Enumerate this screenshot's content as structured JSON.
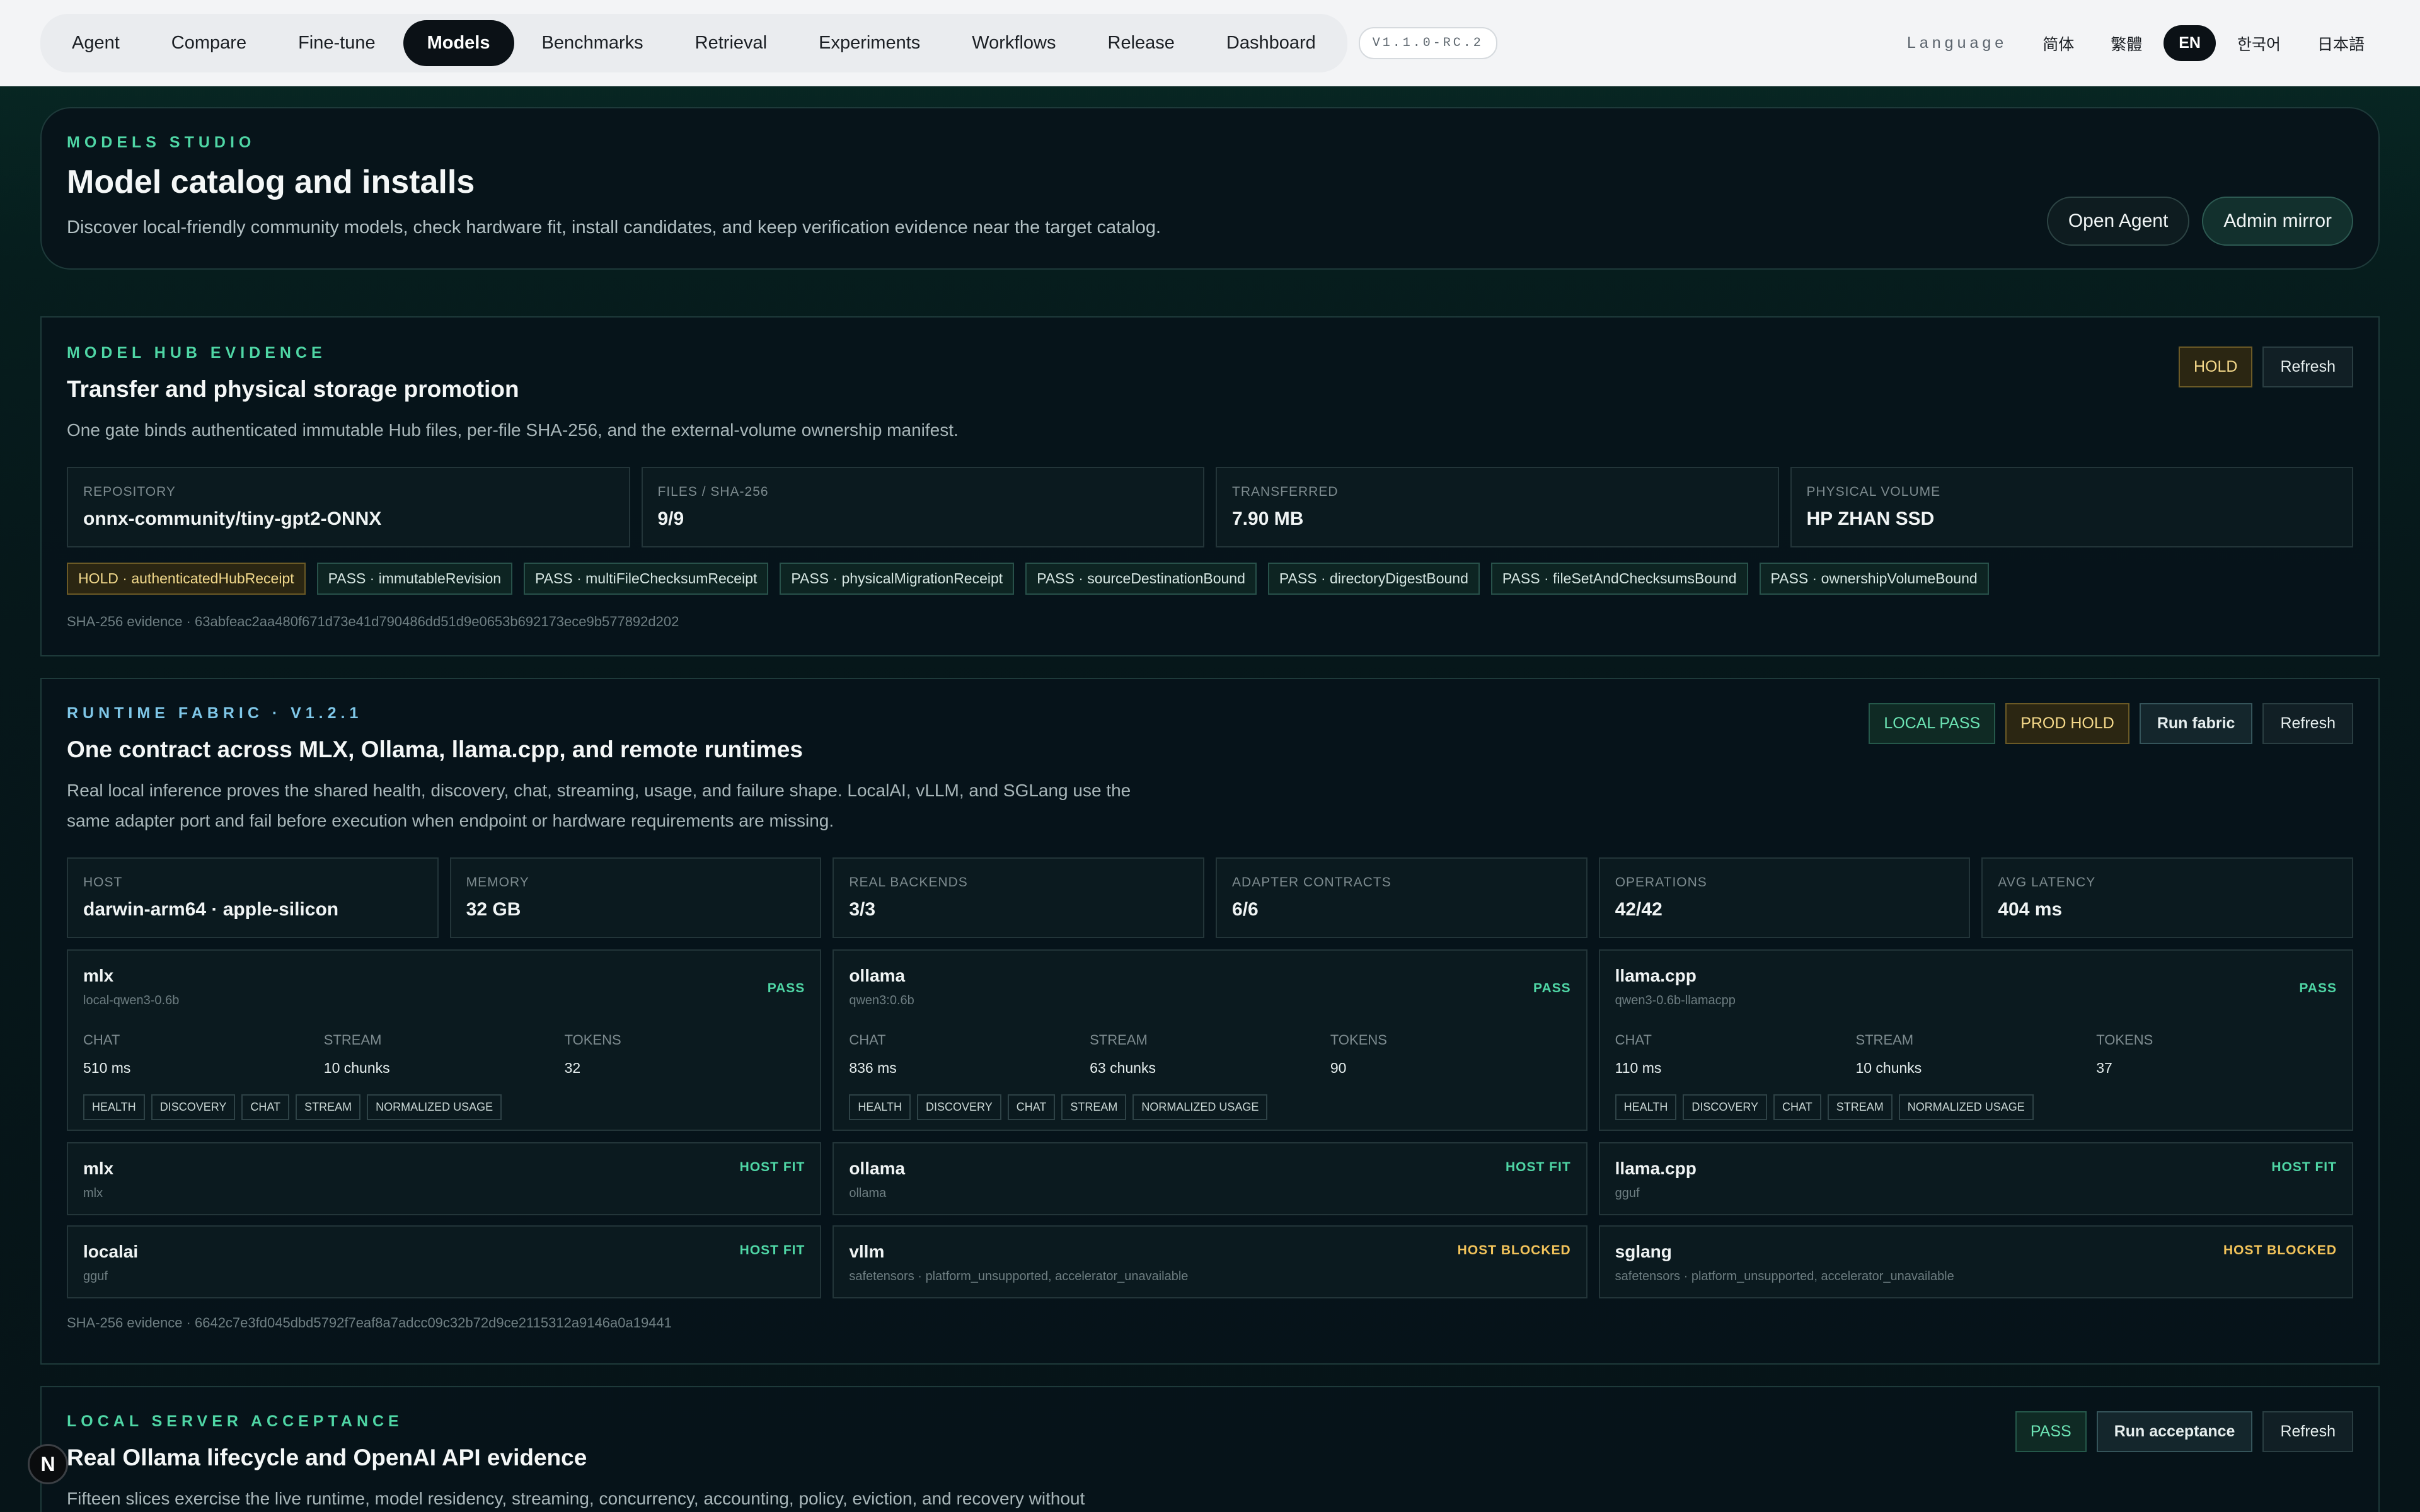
{
  "nav": {
    "items": [
      "Agent",
      "Compare",
      "Fine-tune",
      "Models",
      "Benchmarks",
      "Retrieval",
      "Experiments",
      "Workflows",
      "Release",
      "Dashboard"
    ],
    "active": "Models",
    "version": "V1.1.0-RC.2"
  },
  "language": {
    "label": "Language",
    "options": [
      "简体",
      "繁體",
      "EN",
      "한국어",
      "日本語"
    ],
    "active": "EN"
  },
  "hero": {
    "eyebrow": "MODELS STUDIO",
    "title": "Model catalog and installs",
    "description": "Discover local-friendly community models, check hardware fit, install candidates, and keep verification evidence near the target catalog.",
    "open_agent": "Open Agent",
    "admin_mirror": "Admin mirror"
  },
  "hub": {
    "eyebrow": "MODEL HUB EVIDENCE",
    "title": "Transfer and physical storage promotion",
    "description": "One gate binds authenticated immutable Hub files, per-file SHA-256, and the external-volume ownership manifest.",
    "status": "HOLD",
    "refresh": "Refresh",
    "stats": [
      {
        "label": "REPOSITORY",
        "value": "onnx-community/tiny-gpt2-ONNX"
      },
      {
        "label": "FILES / SHA-256",
        "value": "9/9"
      },
      {
        "label": "TRANSFERRED",
        "value": "7.90 MB"
      },
      {
        "label": "PHYSICAL VOLUME",
        "value": "HP ZHAN SSD"
      }
    ],
    "checks": [
      {
        "text": "HOLD · authenticatedHubReceipt",
        "state": "hold"
      },
      {
        "text": "PASS · immutableRevision",
        "state": "pass"
      },
      {
        "text": "PASS · multiFileChecksumReceipt",
        "state": "pass"
      },
      {
        "text": "PASS · physicalMigrationReceipt",
        "state": "pass"
      },
      {
        "text": "PASS · sourceDestinationBound",
        "state": "pass"
      },
      {
        "text": "PASS · directoryDigestBound",
        "state": "pass"
      },
      {
        "text": "PASS · fileSetAndChecksumsBound",
        "state": "pass"
      },
      {
        "text": "PASS · ownershipVolumeBound",
        "state": "pass"
      }
    ],
    "evidence": "SHA-256 evidence · 63abfeac2aa480f671d73e41d790486dd51d9e0653b692173ece9b577892d202"
  },
  "runtime": {
    "eyebrow": "RUNTIME FABRIC · V1.2.1",
    "title": "One contract across MLX, Ollama, llama.cpp, and remote runtimes",
    "description_1": "Real local inference proves the shared health, discovery, chat, streaming, usage, and failure shape. LocalAI, vLLM, and SGLang use the",
    "description_2": "same adapter port and fail before execution when endpoint or hardware requirements are missing.",
    "local_pass": "LOCAL PASS",
    "prod_hold": "PROD HOLD",
    "run_fabric": "Run fabric",
    "refresh": "Refresh",
    "stats": [
      {
        "label": "HOST",
        "value": "darwin-arm64 · apple-silicon"
      },
      {
        "label": "MEMORY",
        "value": "32 GB"
      },
      {
        "label": "REAL BACKENDS",
        "value": "3/3"
      },
      {
        "label": "ADAPTER CONTRACTS",
        "value": "6/6"
      },
      {
        "label": "OPERATIONS",
        "value": "42/42"
      },
      {
        "label": "AVG LATENCY",
        "value": "404 ms"
      }
    ],
    "backends": [
      {
        "name": "mlx",
        "model": "local-qwen3-0.6b",
        "status": "PASS",
        "chat_label": "CHAT",
        "chat": "510 ms",
        "stream_label": "STREAM",
        "stream": "10 chunks",
        "tokens_label": "TOKENS",
        "tokens": "32"
      },
      {
        "name": "ollama",
        "model": "qwen3:0.6b",
        "status": "PASS",
        "chat_label": "CHAT",
        "chat": "836 ms",
        "stream_label": "STREAM",
        "stream": "63 chunks",
        "tokens_label": "TOKENS",
        "tokens": "90"
      },
      {
        "name": "llama.cpp",
        "model": "qwen3-0.6b-llamacpp",
        "status": "PASS",
        "chat_label": "CHAT",
        "chat": "110 ms",
        "stream_label": "STREAM",
        "stream": "10 chunks",
        "tokens_label": "TOKENS",
        "tokens": "37"
      }
    ],
    "tags": [
      "HEALTH",
      "DISCOVERY",
      "CHAT",
      "STREAM",
      "NORMALIZED USAGE"
    ],
    "fits": [
      {
        "name": "mlx",
        "format": "mlx",
        "status": "HOST FIT"
      },
      {
        "name": "ollama",
        "format": "ollama",
        "status": "HOST FIT"
      },
      {
        "name": "llama.cpp",
        "format": "gguf",
        "status": "HOST FIT"
      },
      {
        "name": "localai",
        "format": "gguf",
        "status": "HOST FIT"
      },
      {
        "name": "vllm",
        "format": "safetensors · platform_unsupported, accelerator_unavailable",
        "status": "HOST BLOCKED"
      },
      {
        "name": "sglang",
        "format": "safetensors · platform_unsupported, accelerator_unavailable",
        "status": "HOST BLOCKED"
      }
    ],
    "evidence": "SHA-256 evidence · 6642c7e3fd045dbd5792f7eaf8a7adcc09c32b72d9ce2115312a9146a0a19441"
  },
  "server": {
    "eyebrow": "LOCAL SERVER ACCEPTANCE",
    "title": "Real Ollama lifecycle and OpenAI API evidence",
    "description": "Fifteen slices exercise the live runtime, model residency, streaming, concurrency, accounting, policy, eviction, and recovery without",
    "status": "PASS",
    "run_acceptance": "Run acceptance",
    "refresh": "Refresh"
  },
  "fab_letter": "N",
  "colors": {
    "accent": "#4fd6a5",
    "hold": "#f5d98a",
    "blocked": "#f2c35a",
    "background": "#061d1d"
  }
}
